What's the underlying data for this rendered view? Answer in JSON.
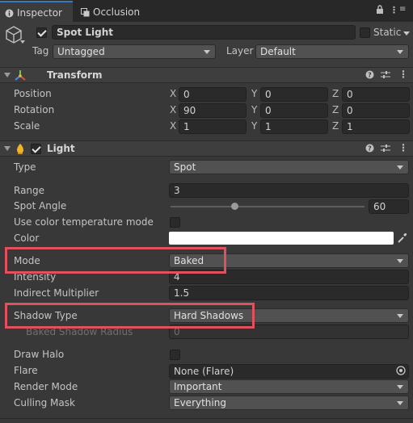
{
  "tabs": [
    {
      "label": "Inspector",
      "icon": "info-icon"
    },
    {
      "label": "Occlusion",
      "icon": "occlusion-icon"
    }
  ],
  "header": {
    "object_name": "Spot Light",
    "enabled": true,
    "static_label": "Static",
    "tag_label": "Tag",
    "tag_value": "Untagged",
    "layer_label": "Layer",
    "layer_value": "Default"
  },
  "transform": {
    "title": "Transform",
    "rows": [
      {
        "label": "Position",
        "x": "0",
        "y": "0",
        "z": "0"
      },
      {
        "label": "Rotation",
        "x": "90",
        "y": "0",
        "z": "0"
      },
      {
        "label": "Scale",
        "x": "1",
        "y": "1",
        "z": "1"
      }
    ],
    "axes": [
      "X",
      "Y",
      "Z"
    ]
  },
  "light": {
    "title": "Light",
    "enabled": true,
    "type_label": "Type",
    "type_value": "Spot",
    "range_label": "Range",
    "range_value": "3",
    "spot_angle_label": "Spot Angle",
    "spot_angle_value": "60",
    "spot_angle_fraction": 0.33,
    "color_temp_label": "Use color temperature mode",
    "color_label": "Color",
    "color_value": "#ffffff",
    "mode_label": "Mode",
    "mode_value": "Baked",
    "intensity_label": "Intensity",
    "intensity_value": "4",
    "indirect_label": "Indirect Multiplier",
    "indirect_value": "1.5",
    "shadow_type_label": "Shadow Type",
    "shadow_type_value": "Hard Shadows",
    "baked_radius_label": "Baked Shadow Radius",
    "baked_radius_value": "0",
    "draw_halo_label": "Draw Halo",
    "flare_label": "Flare",
    "flare_value": "None (Flare)",
    "render_mode_label": "Render Mode",
    "render_mode_value": "Important",
    "culling_mask_label": "Culling Mask",
    "culling_mask_value": "Everything"
  },
  "colors": {
    "highlight": "#e0505f",
    "accent": "#3a79bb"
  }
}
